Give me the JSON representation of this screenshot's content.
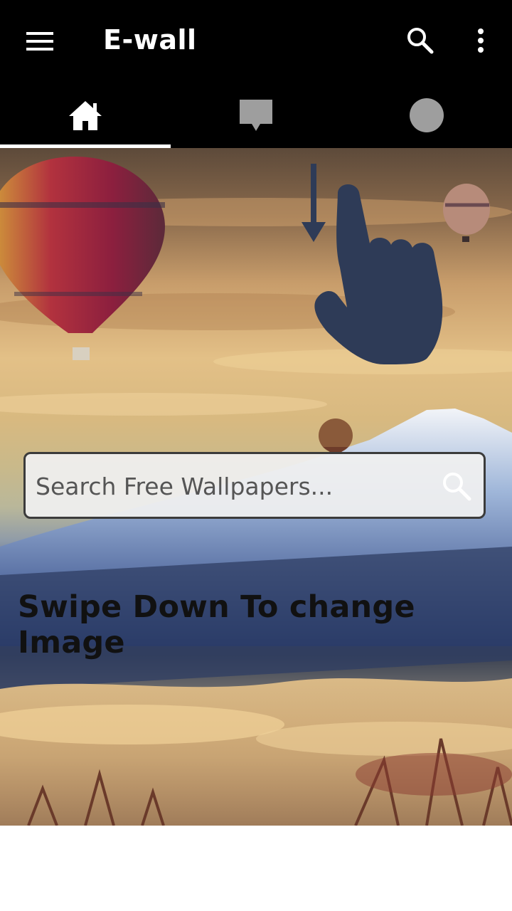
{
  "app": {
    "title": "E-wall"
  },
  "toolbar": {
    "menu_icon": "hamburger-menu-icon",
    "search_icon": "search-icon",
    "more_icon": "more-vertical-icon"
  },
  "tabs": [
    {
      "icon": "home-icon",
      "selected": true
    },
    {
      "icon": "chat-bubble-icon",
      "selected": false
    },
    {
      "icon": "circle-icon",
      "selected": false
    }
  ],
  "hero": {
    "background": "hot-air-balloons-over-mountain-photo",
    "gesture_icon": "swipe-down-hand-icon",
    "search": {
      "placeholder": "Search Free Wallpapers...",
      "icon": "search-icon"
    },
    "hint": "Swipe Down To change Image"
  },
  "colors": {
    "bar": "#000000",
    "tab_active": "#ffffff",
    "tab_inactive": "#9e9e9e",
    "hand": "#2e3b57"
  }
}
